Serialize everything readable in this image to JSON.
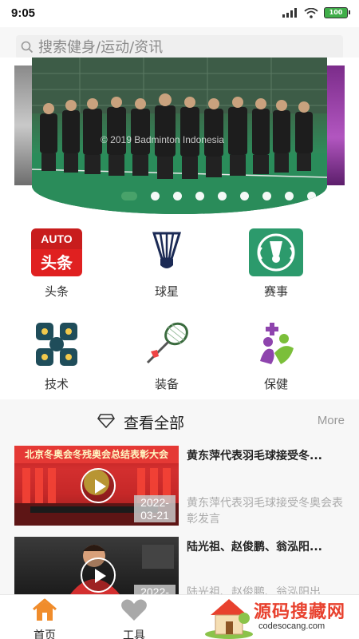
{
  "status": {
    "time": "9:05",
    "battery": "100"
  },
  "search": {
    "placeholder": "搜索健身/运动/资讯"
  },
  "banner": {
    "caption": "© 2019 Badminton Indonesia",
    "dot_count": 9,
    "active_dot": 0
  },
  "categories": [
    {
      "label": "头条",
      "badge_top": "AUTO",
      "badge_bottom": "头条",
      "icon": "toutiao-icon"
    },
    {
      "label": "球星",
      "icon": "shuttlecock-icon"
    },
    {
      "label": "赛事",
      "icon": "tournament-icon"
    },
    {
      "label": "技术",
      "icon": "technique-icon"
    },
    {
      "label": "装备",
      "icon": "racket-icon"
    },
    {
      "label": "保健",
      "icon": "health-icon"
    }
  ],
  "section": {
    "title": "查看全部",
    "more": "More"
  },
  "news": [
    {
      "title": "黄东萍代表羽毛球接受冬...",
      "desc": "黄东萍代表羽毛球接受冬奥会表彰发言",
      "date_line1": "2022-",
      "date_line2": "03-21",
      "thumb_banner": "北京冬奥会冬残奥会总结表彰大会"
    },
    {
      "title": "陆光祖、赵俊鹏、翁泓阳...",
      "desc": "陆光祖、赵俊鹏、翁泓阳出",
      "date_line1": "2022-"
    }
  ],
  "tabs": [
    {
      "label": "首页",
      "icon": "home-icon",
      "active": true
    },
    {
      "label": "工具",
      "icon": "heart-icon",
      "active": false
    }
  ],
  "watermark": {
    "title": "源码搜藏网",
    "subtitle": "codesocang.com"
  },
  "colors": {
    "accent": "#f08c2b",
    "brand_green": "#3fa86a",
    "tab_inactive": "#a9a9a9"
  }
}
